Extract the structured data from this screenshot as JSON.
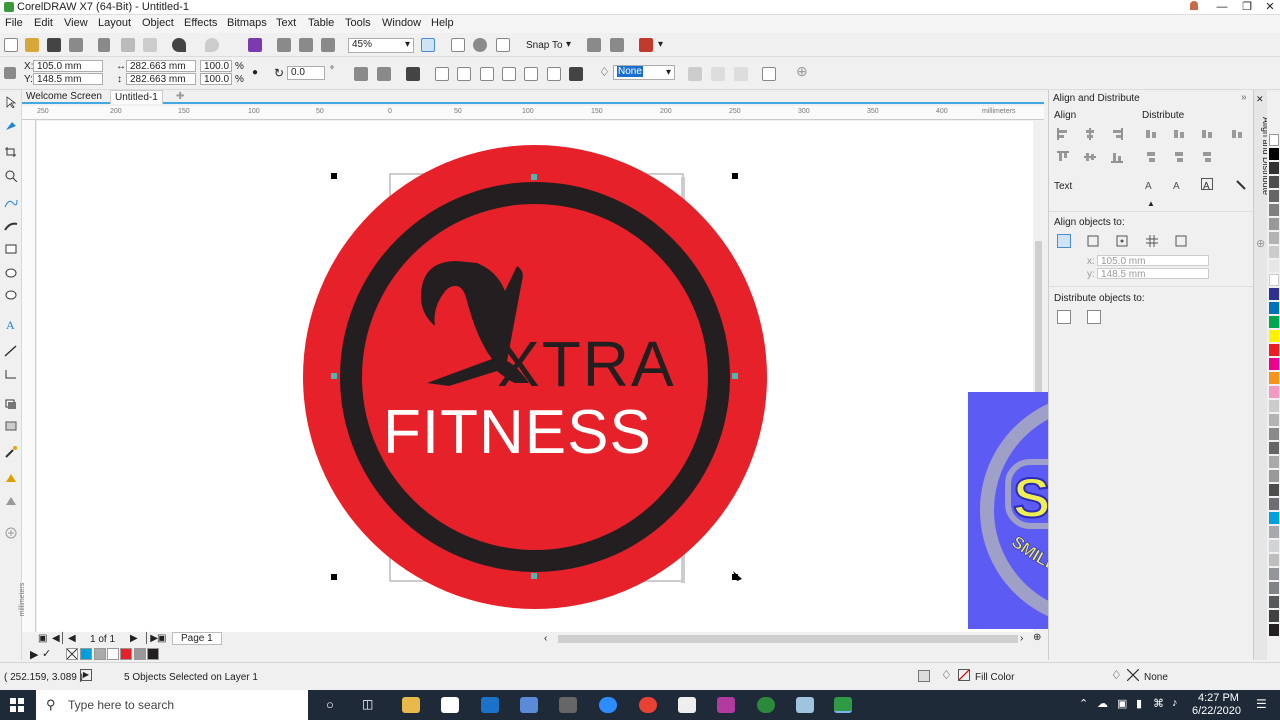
{
  "window": {
    "title": "CorelDRAW X7 (64-Bit) - Untitled-1"
  },
  "menu": [
    "File",
    "Edit",
    "View",
    "Layout",
    "Object",
    "Effects",
    "Bitmaps",
    "Text",
    "Table",
    "Tools",
    "Window",
    "Help"
  ],
  "standard_toolbar": {
    "zoom": "45%",
    "snap_to": "Snap To"
  },
  "property_bar": {
    "x": "105.0 mm",
    "y": "148.5 mm",
    "width": "282.663 mm",
    "height": "282.663 mm",
    "scale_x": "100.0",
    "scale_y": "100.0",
    "percent": "%",
    "rotation": "0.0",
    "degree": "°",
    "outline": "None"
  },
  "doc_tabs": [
    "Welcome Screen",
    "Untitled-1"
  ],
  "ruler": {
    "unit": "millimeters",
    "h_ticks": [
      "250",
      "200",
      "150",
      "100",
      "50",
      "0",
      "50",
      "100",
      "150",
      "200",
      "250",
      "300",
      "350",
      "400"
    ],
    "v_unit": "millimeters"
  },
  "artwork": {
    "line1": "XTRA",
    "line2": "FITNESS",
    "colors": {
      "red": "#e62129",
      "ring": "#231f20",
      "white": "#ffffff"
    }
  },
  "watermark": {
    "initials": "SGD",
    "tagline": "SMILE GRAPHIC DESIGNS",
    "bg": "#5c5cf5",
    "text_color": "#f0ef50"
  },
  "page_nav": {
    "page_count": "1 of 1",
    "page_tab": "Page 1"
  },
  "status": {
    "coords": "( 252.159, 3.089 )",
    "selection": "5 Objects Selected on Layer 1",
    "fill_label": "Fill Color",
    "outline_label": "None"
  },
  "docker": {
    "title": "Align and Distribute",
    "align": "Align",
    "distribute": "Distribute",
    "text": "Text",
    "align_objects_to": "Align objects to:",
    "x_value": "105.0 mm",
    "y_value": "148.5 mm",
    "distribute_objects_to": "Distribute objects to:",
    "side_tab": "Align and Distribute"
  },
  "taskbar": {
    "search": "Type here to search",
    "time": "4:27 PM",
    "date": "6/22/2020"
  }
}
